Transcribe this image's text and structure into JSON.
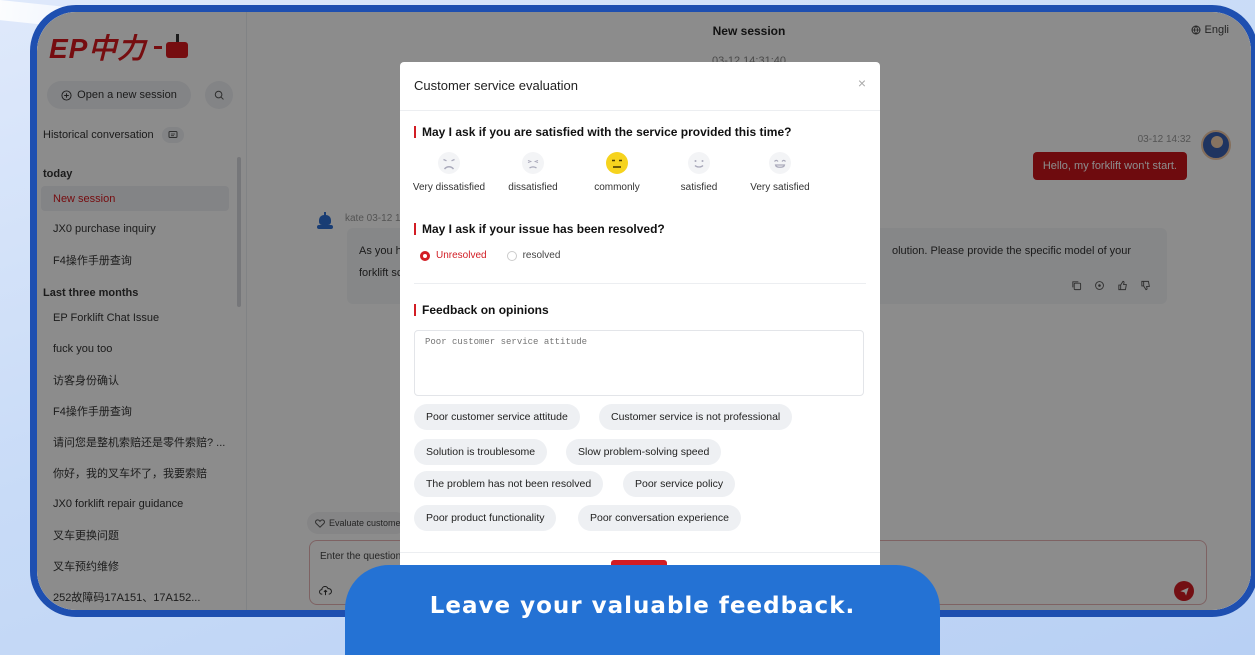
{
  "sidebar": {
    "logo_text": "EP中力",
    "new_session_label": "Open a new session",
    "history_heading": "Historical conversation",
    "groups": {
      "today": "today",
      "last_three_months": "Last three months"
    },
    "today_items": [
      {
        "label": "New session"
      },
      {
        "label": "JX0 purchase inquiry"
      },
      {
        "label": "F4操作手册查询"
      }
    ],
    "recent_items": [
      {
        "label": "EP Forklift Chat Issue"
      },
      {
        "label": "fuck you too"
      },
      {
        "label": "访客身份确认"
      },
      {
        "label": "F4操作手册查询"
      },
      {
        "label": "请问您是整机索赔还是零件索赔? ..."
      },
      {
        "label": "你好，我的叉车坏了，我要索赔"
      },
      {
        "label": "JX0 forklift repair guidance"
      },
      {
        "label": "叉车更换问题"
      },
      {
        "label": "叉车预约维修"
      },
      {
        "label": "252故障码17A151、17A152..."
      }
    ]
  },
  "chat": {
    "title": "New session",
    "date": "03-12 14:31:40",
    "language": "Engli",
    "user_time": "03-12 14:32",
    "user_message": "Hello, my forklift won't start.",
    "bot_meta": "kate  03-12 1",
    "bot_text_left": "As you h forklift sc",
    "bot_text_right": "olution. Please provide the specific model of your",
    "evaluate_label": "Evaluate custome",
    "input_placeholder": "Enter the question,"
  },
  "modal": {
    "title": "Customer service evaluation",
    "q1": "May I ask if you are satisfied with the service provided this time?",
    "ratings": [
      {
        "label": "Very dissatisfied",
        "selected": false
      },
      {
        "label": "dissatisfied",
        "selected": false
      },
      {
        "label": "commonly",
        "selected": true
      },
      {
        "label": "satisfied",
        "selected": false
      },
      {
        "label": "Very satisfied",
        "selected": false
      }
    ],
    "q2": "May I ask if your issue has been resolved?",
    "resolved_options": [
      {
        "label": "Unresolved",
        "selected": true
      },
      {
        "label": "resolved",
        "selected": false
      }
    ],
    "q3": "Feedback on opinions",
    "feedback_placeholder": "Poor customer service attitude",
    "chips": [
      "Poor customer service attitude",
      "Customer service is not professional",
      "Solution is troublesome",
      "Slow problem-solving speed",
      "The problem has not been resolved",
      "Poor service policy",
      "Poor product functionality",
      "Poor conversation experience"
    ],
    "submit_label": "Submit"
  },
  "banner_text": "Leave your valuable feedback.",
  "colors": {
    "brand_red": "#d21d24",
    "frame_blue": "#1e4fb0",
    "banner_blue": "#2472d4",
    "selected_face": "#f6d31e"
  }
}
